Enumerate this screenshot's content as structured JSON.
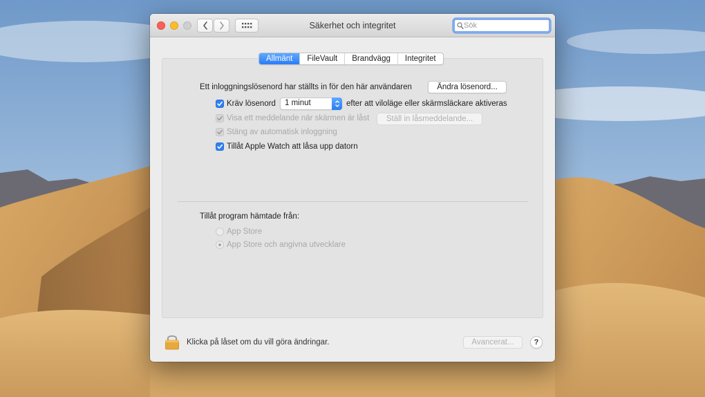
{
  "window": {
    "title": "Säkerhet och integritet",
    "search_placeholder": "Sök"
  },
  "tabs": [
    {
      "label": "Allmänt",
      "active": true
    },
    {
      "label": "FileVault",
      "active": false
    },
    {
      "label": "Brandvägg",
      "active": false
    },
    {
      "label": "Integritet",
      "active": false
    }
  ],
  "general": {
    "password_text": "Ett inloggningslösenord har ställts in för den här användaren",
    "change_password_button": "Ändra lösenord...",
    "require_password": {
      "label": "Kräv lösenord",
      "checked": true
    },
    "require_password_delay": "1 minut",
    "require_password_suffix": "efter att viloläge eller skärmsläckare aktiveras",
    "show_message": {
      "label": "Visa ett meddelande när skärmen är låst",
      "checked": true,
      "enabled": false
    },
    "set_lock_message_button": "Ställ in låsmeddelande...",
    "disable_auto_login": {
      "label": "Stäng av automatisk inloggning",
      "checked": true,
      "enabled": false
    },
    "apple_watch_unlock": {
      "label": "Tillåt Apple Watch att låsa upp datorn",
      "checked": true
    }
  },
  "downloads": {
    "heading": "Tillåt program hämtade från:",
    "options": [
      {
        "label": "App Store",
        "selected": false
      },
      {
        "label": "App Store och angivna utvecklare",
        "selected": true
      }
    ]
  },
  "footer": {
    "lock_text": "Klicka på låset om du vill göra ändringar.",
    "advanced_button": "Avancerat...",
    "help_label": "?"
  },
  "icons": {
    "back": "chevron-left-icon",
    "forward": "chevron-right-icon",
    "show_all": "grid-icon",
    "search": "magnifier-icon",
    "lock": "padlock-icon",
    "checkbox": "checkmark-icon"
  },
  "colors": {
    "accent": "#2b7cf5",
    "close": "#fc5f57",
    "minimize": "#fdbc2e",
    "zoom": "#cfcfcf",
    "lock": "#e8a93c"
  }
}
